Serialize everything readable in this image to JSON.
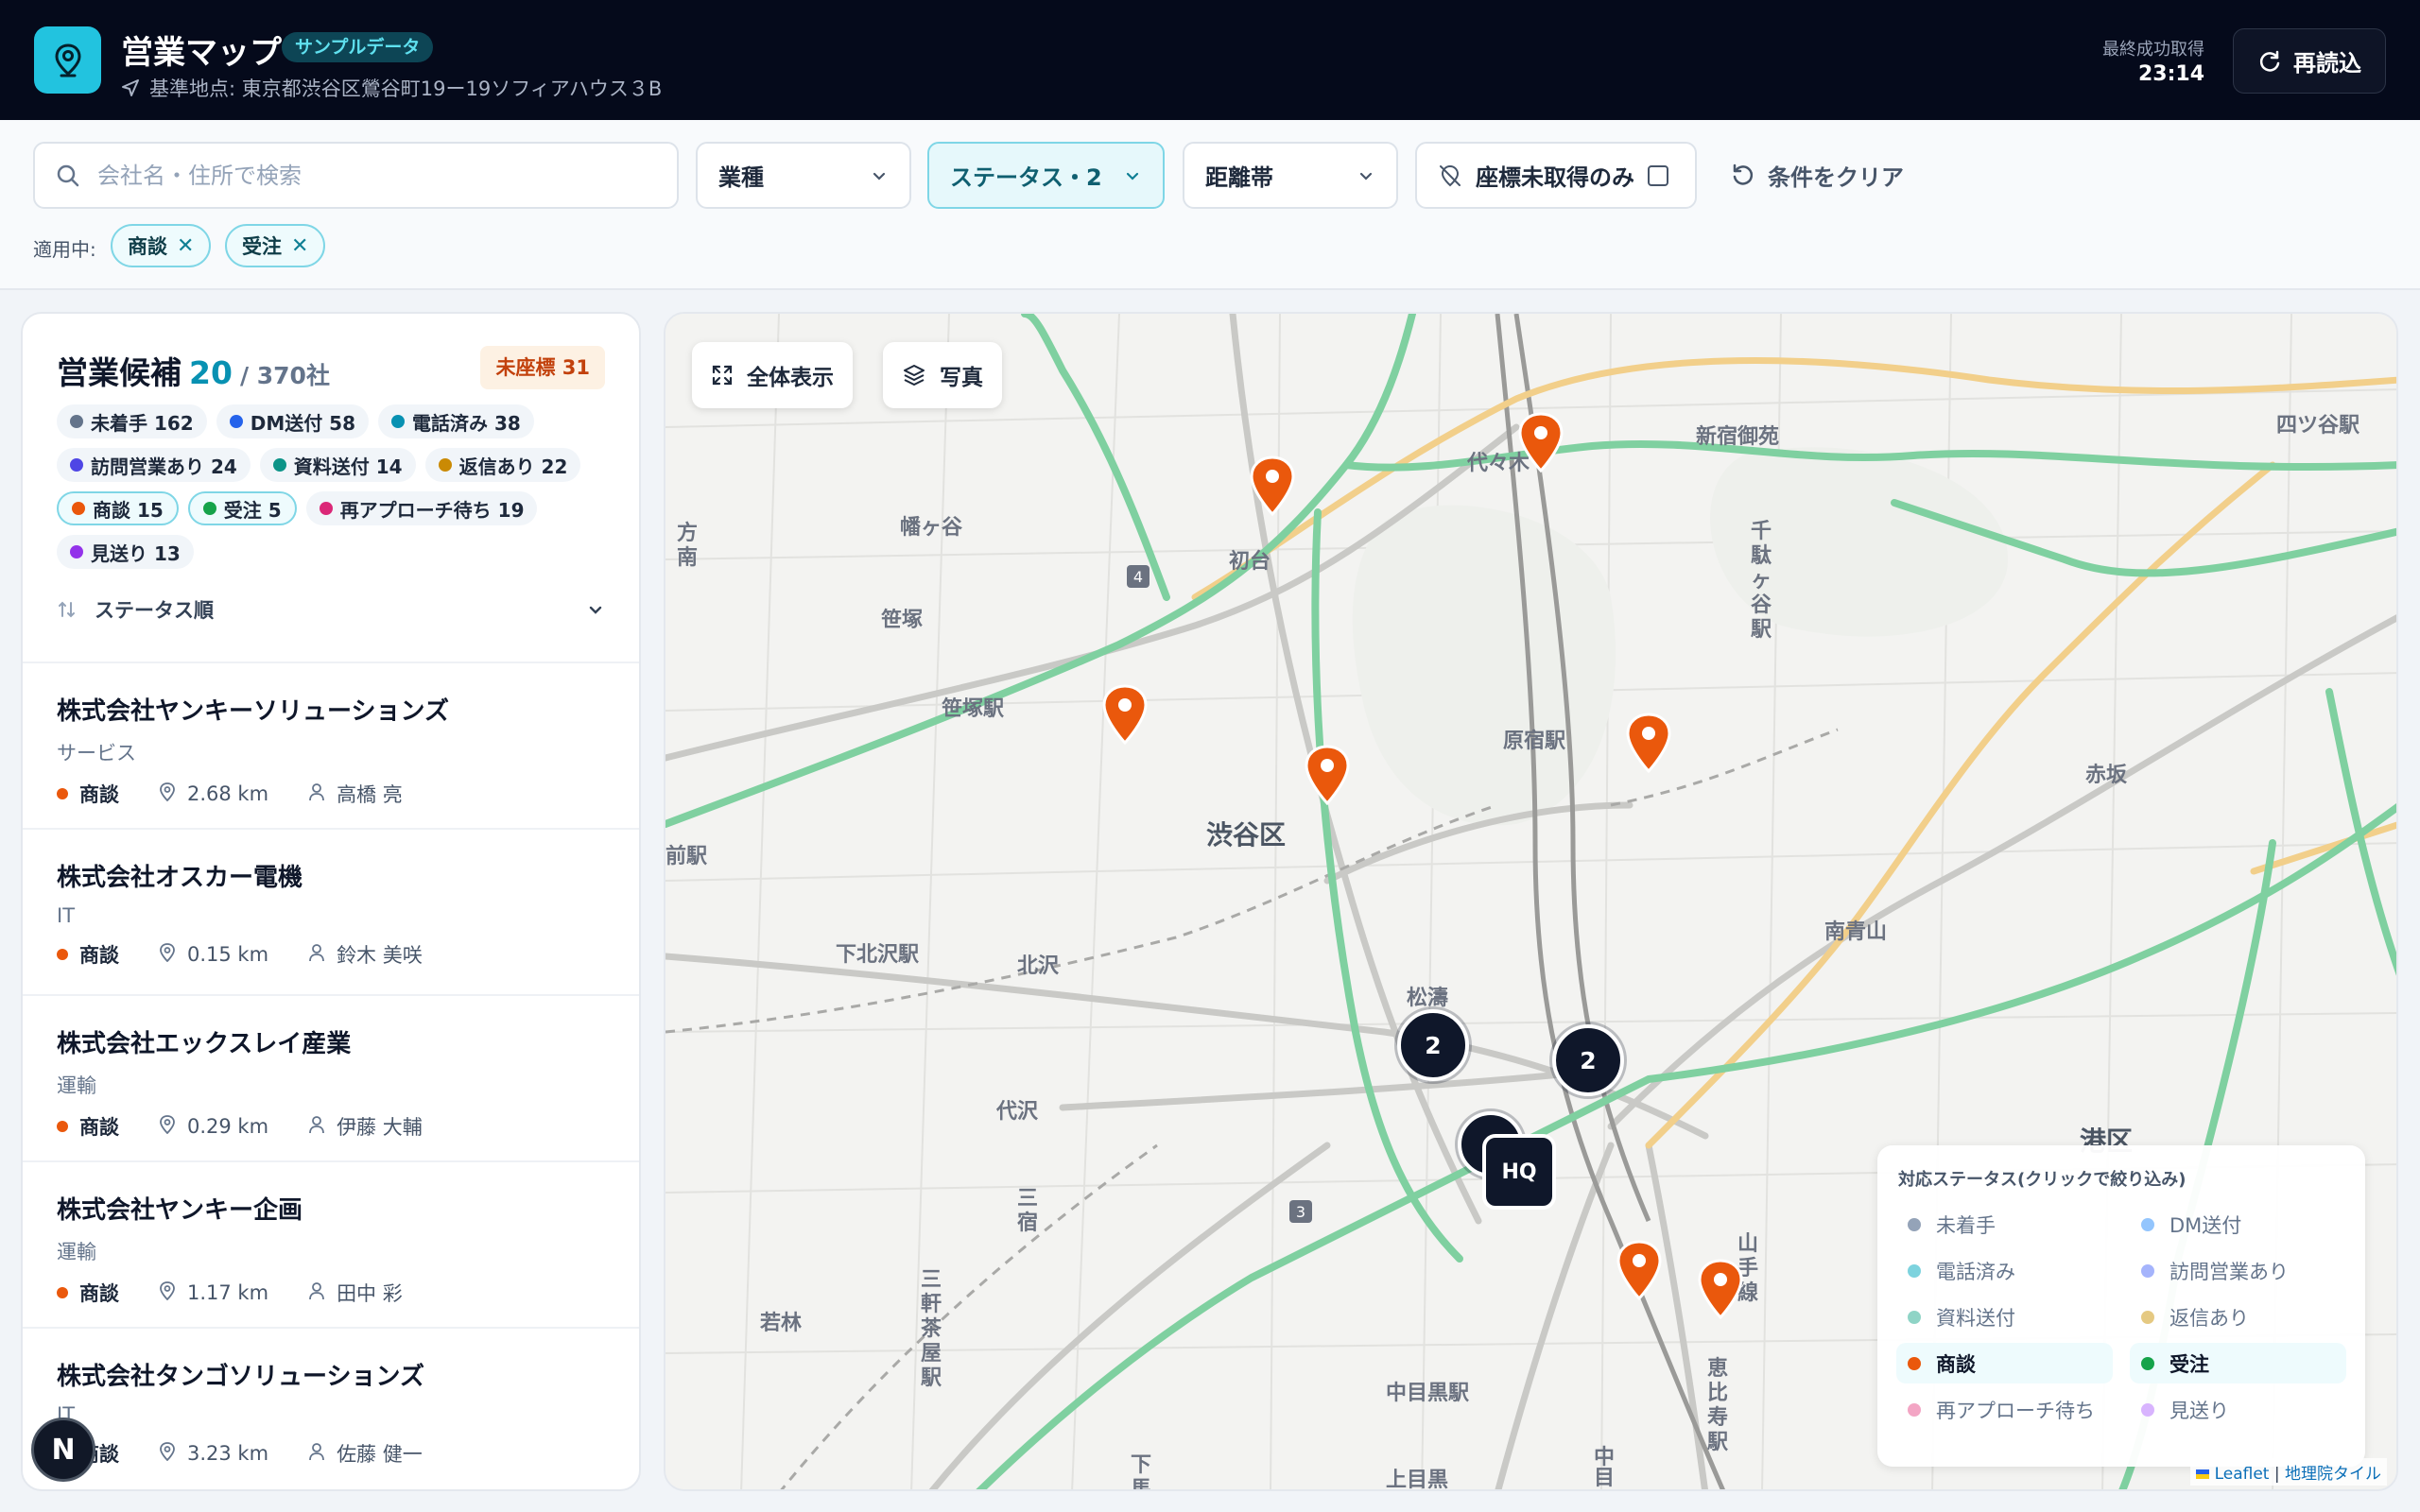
{
  "header": {
    "app_title": "営業マップ",
    "sample_badge": "サンプルデータ",
    "base_location": "基準地点: 東京都渋谷区鶯谷町19ー19ソフィアハウス３B",
    "last_fetch_label": "最終成功取得",
    "last_fetch_time": "23:14",
    "reload_label": "再読込"
  },
  "filters": {
    "search_placeholder": "会社名・住所で検索",
    "industry_label": "業種",
    "status_label": "ステータス・2",
    "distance_label": "距離帯",
    "coord_missing_label": "座標未取得のみ",
    "clear_label": "条件をクリア",
    "applied_label": "適用中:",
    "applied_chips": [
      "商談",
      "受注"
    ]
  },
  "panel": {
    "title": "営業候補",
    "count": "20",
    "total": "/ 370社",
    "no_coord_badge": "未座標 31",
    "status_badges": [
      {
        "label": "未着手 162",
        "color": "#64748b",
        "active": false
      },
      {
        "label": "DM送付 58",
        "color": "#2563eb",
        "active": false
      },
      {
        "label": "電話済み 38",
        "color": "#0891b2",
        "active": false
      },
      {
        "label": "訪問営業あり 24",
        "color": "#4f46e5",
        "active": false
      },
      {
        "label": "資料送付 14",
        "color": "#0d9488",
        "active": false
      },
      {
        "label": "返信あり 22",
        "color": "#ca8a04",
        "active": false
      },
      {
        "label": "商談 15",
        "color": "#ea580c",
        "active": true
      },
      {
        "label": "受注 5",
        "color": "#16a34a",
        "active": true
      },
      {
        "label": "再アプローチ待ち 19",
        "color": "#db2777",
        "active": false
      },
      {
        "label": "見送り 13",
        "color": "#9333ea",
        "active": false
      }
    ],
    "sort_label": "ステータス順",
    "companies": [
      {
        "name": "株式会社ヤンキーソリューションズ",
        "industry": "サービス",
        "status": "商談",
        "distance": "2.68 km",
        "owner": "高橋 亮"
      },
      {
        "name": "株式会社オスカー電機",
        "industry": "IT",
        "status": "商談",
        "distance": "0.15 km",
        "owner": "鈴木 美咲"
      },
      {
        "name": "株式会社エックスレイ産業",
        "industry": "運輸",
        "status": "商談",
        "distance": "0.29 km",
        "owner": "伊藤 大輔"
      },
      {
        "name": "株式会社ヤンキー企画",
        "industry": "運輸",
        "status": "商談",
        "distance": "1.17 km",
        "owner": "田中 彩"
      },
      {
        "name": "株式会社タンゴソリューションズ",
        "industry": "IT",
        "status": "商談",
        "distance": "3.23 km",
        "owner": "佐藤 健一"
      }
    ],
    "n_badge": "N"
  },
  "map": {
    "fit_label": "全体表示",
    "photo_label": "写真",
    "clusters": [
      "2",
      "2"
    ],
    "hq_label": "HQ",
    "place_labels": [
      "新宿御苑",
      "四ツ谷駅",
      "代々木",
      "幡ヶ谷",
      "初台",
      "笹塚",
      "笹塚駅",
      "千駄ヶ谷駅",
      "原宿駅",
      "渋谷区",
      "赤坂",
      "下北沢駅",
      "北沢",
      "南青山",
      "松濤",
      "代沢",
      "港区",
      "三宿",
      "三軒茶屋駅",
      "若林",
      "中目黒駅",
      "恵比寿駅",
      "山手線",
      "上目黒",
      "中目",
      "代々木",
      "方南",
      "前駅",
      "下馬"
    ],
    "legend": {
      "title": "対応ステータス(クリックで絞り込み)",
      "items": [
        {
          "label": "未着手",
          "color": "#94a3b8",
          "active": false
        },
        {
          "label": "DM送付",
          "color": "#93c5fd",
          "active": false
        },
        {
          "label": "電話済み",
          "color": "#7dd3de",
          "active": false
        },
        {
          "label": "訪問営業あり",
          "color": "#a5b4fc",
          "active": false
        },
        {
          "label": "資料送付",
          "color": "#8fd4c6",
          "active": false
        },
        {
          "label": "返信あり",
          "color": "#e5c982",
          "active": false
        },
        {
          "label": "商談",
          "color": "#ea580c",
          "active": true
        },
        {
          "label": "受注",
          "color": "#16a34a",
          "active": true
        },
        {
          "label": "再アプローチ待ち",
          "color": "#f3a5c4",
          "active": false
        },
        {
          "label": "見送り",
          "color": "#d8b4fe",
          "active": false
        }
      ]
    },
    "attribution_leaflet": "Leaflet",
    "attribution_sep": " | ",
    "attribution_tiles": "地理院タイル"
  }
}
